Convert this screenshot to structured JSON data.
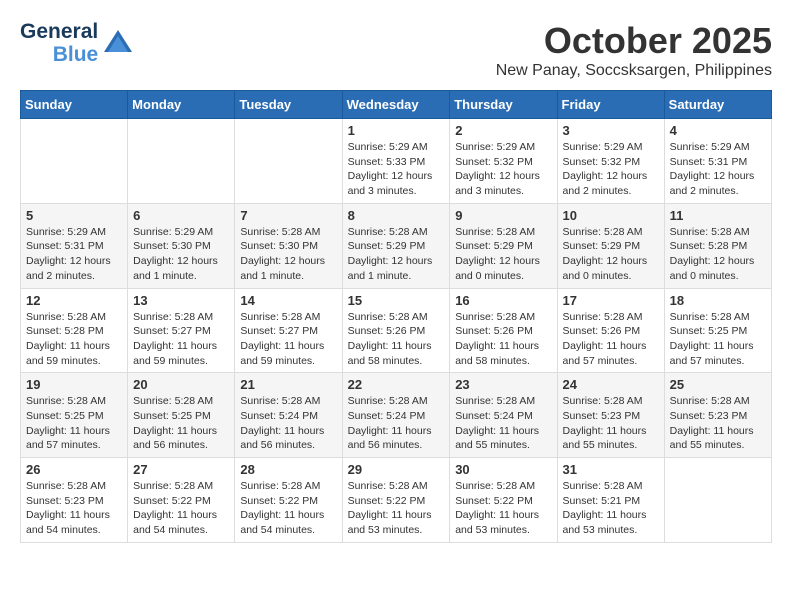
{
  "logo": {
    "general": "General",
    "blue": "Blue"
  },
  "header": {
    "month": "October 2025",
    "location": "New Panay, Soccsksargen, Philippines"
  },
  "weekdays": [
    "Sunday",
    "Monday",
    "Tuesday",
    "Wednesday",
    "Thursday",
    "Friday",
    "Saturday"
  ],
  "weeks": [
    [
      {
        "day": "",
        "info": ""
      },
      {
        "day": "",
        "info": ""
      },
      {
        "day": "",
        "info": ""
      },
      {
        "day": "1",
        "info": "Sunrise: 5:29 AM\nSunset: 5:33 PM\nDaylight: 12 hours\nand 3 minutes."
      },
      {
        "day": "2",
        "info": "Sunrise: 5:29 AM\nSunset: 5:32 PM\nDaylight: 12 hours\nand 3 minutes."
      },
      {
        "day": "3",
        "info": "Sunrise: 5:29 AM\nSunset: 5:32 PM\nDaylight: 12 hours\nand 2 minutes."
      },
      {
        "day": "4",
        "info": "Sunrise: 5:29 AM\nSunset: 5:31 PM\nDaylight: 12 hours\nand 2 minutes."
      }
    ],
    [
      {
        "day": "5",
        "info": "Sunrise: 5:29 AM\nSunset: 5:31 PM\nDaylight: 12 hours\nand 2 minutes."
      },
      {
        "day": "6",
        "info": "Sunrise: 5:29 AM\nSunset: 5:30 PM\nDaylight: 12 hours\nand 1 minute."
      },
      {
        "day": "7",
        "info": "Sunrise: 5:28 AM\nSunset: 5:30 PM\nDaylight: 12 hours\nand 1 minute."
      },
      {
        "day": "8",
        "info": "Sunrise: 5:28 AM\nSunset: 5:29 PM\nDaylight: 12 hours\nand 1 minute."
      },
      {
        "day": "9",
        "info": "Sunrise: 5:28 AM\nSunset: 5:29 PM\nDaylight: 12 hours\nand 0 minutes."
      },
      {
        "day": "10",
        "info": "Sunrise: 5:28 AM\nSunset: 5:29 PM\nDaylight: 12 hours\nand 0 minutes."
      },
      {
        "day": "11",
        "info": "Sunrise: 5:28 AM\nSunset: 5:28 PM\nDaylight: 12 hours\nand 0 minutes."
      }
    ],
    [
      {
        "day": "12",
        "info": "Sunrise: 5:28 AM\nSunset: 5:28 PM\nDaylight: 11 hours\nand 59 minutes."
      },
      {
        "day": "13",
        "info": "Sunrise: 5:28 AM\nSunset: 5:27 PM\nDaylight: 11 hours\nand 59 minutes."
      },
      {
        "day": "14",
        "info": "Sunrise: 5:28 AM\nSunset: 5:27 PM\nDaylight: 11 hours\nand 59 minutes."
      },
      {
        "day": "15",
        "info": "Sunrise: 5:28 AM\nSunset: 5:26 PM\nDaylight: 11 hours\nand 58 minutes."
      },
      {
        "day": "16",
        "info": "Sunrise: 5:28 AM\nSunset: 5:26 PM\nDaylight: 11 hours\nand 58 minutes."
      },
      {
        "day": "17",
        "info": "Sunrise: 5:28 AM\nSunset: 5:26 PM\nDaylight: 11 hours\nand 57 minutes."
      },
      {
        "day": "18",
        "info": "Sunrise: 5:28 AM\nSunset: 5:25 PM\nDaylight: 11 hours\nand 57 minutes."
      }
    ],
    [
      {
        "day": "19",
        "info": "Sunrise: 5:28 AM\nSunset: 5:25 PM\nDaylight: 11 hours\nand 57 minutes."
      },
      {
        "day": "20",
        "info": "Sunrise: 5:28 AM\nSunset: 5:25 PM\nDaylight: 11 hours\nand 56 minutes."
      },
      {
        "day": "21",
        "info": "Sunrise: 5:28 AM\nSunset: 5:24 PM\nDaylight: 11 hours\nand 56 minutes."
      },
      {
        "day": "22",
        "info": "Sunrise: 5:28 AM\nSunset: 5:24 PM\nDaylight: 11 hours\nand 56 minutes."
      },
      {
        "day": "23",
        "info": "Sunrise: 5:28 AM\nSunset: 5:24 PM\nDaylight: 11 hours\nand 55 minutes."
      },
      {
        "day": "24",
        "info": "Sunrise: 5:28 AM\nSunset: 5:23 PM\nDaylight: 11 hours\nand 55 minutes."
      },
      {
        "day": "25",
        "info": "Sunrise: 5:28 AM\nSunset: 5:23 PM\nDaylight: 11 hours\nand 55 minutes."
      }
    ],
    [
      {
        "day": "26",
        "info": "Sunrise: 5:28 AM\nSunset: 5:23 PM\nDaylight: 11 hours\nand 54 minutes."
      },
      {
        "day": "27",
        "info": "Sunrise: 5:28 AM\nSunset: 5:22 PM\nDaylight: 11 hours\nand 54 minutes."
      },
      {
        "day": "28",
        "info": "Sunrise: 5:28 AM\nSunset: 5:22 PM\nDaylight: 11 hours\nand 54 minutes."
      },
      {
        "day": "29",
        "info": "Sunrise: 5:28 AM\nSunset: 5:22 PM\nDaylight: 11 hours\nand 53 minutes."
      },
      {
        "day": "30",
        "info": "Sunrise: 5:28 AM\nSunset: 5:22 PM\nDaylight: 11 hours\nand 53 minutes."
      },
      {
        "day": "31",
        "info": "Sunrise: 5:28 AM\nSunset: 5:21 PM\nDaylight: 11 hours\nand 53 minutes."
      },
      {
        "day": "",
        "info": ""
      }
    ]
  ]
}
